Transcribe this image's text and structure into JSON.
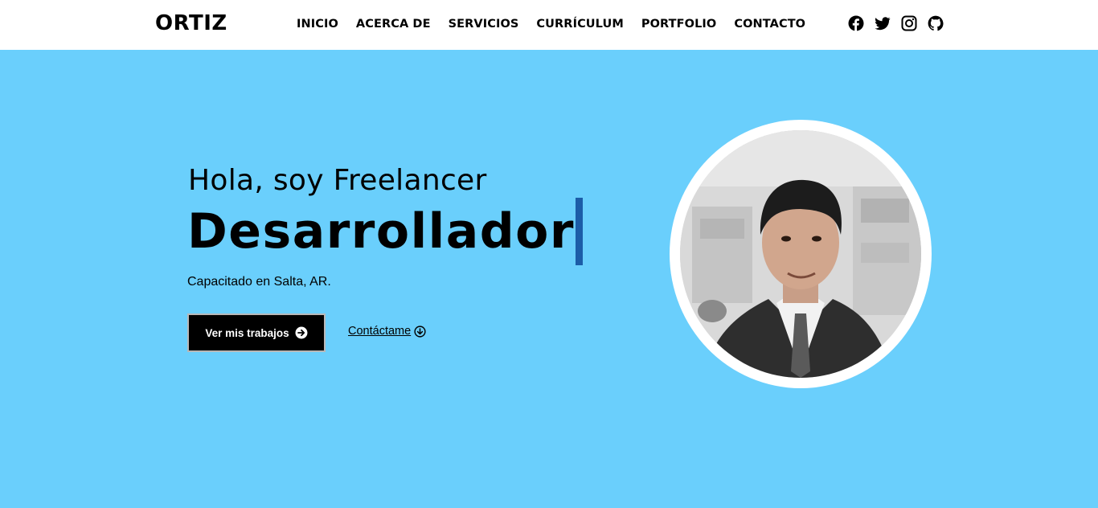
{
  "header": {
    "logo": "ORTIZ",
    "nav": [
      "INICIO",
      "ACERCA DE",
      "SERVICIOS",
      "CURRÍCULUM",
      "PORTFOLIO",
      "CONTACTO"
    ],
    "social_icons": [
      "facebook-icon",
      "twitter-icon",
      "instagram-icon",
      "github-icon"
    ]
  },
  "hero": {
    "intro": "Hola, soy Freelancer",
    "role": "Desarrollador",
    "subtitle": "Capacitado en Salta, AR.",
    "primary_button": "Ver mis trabajos",
    "secondary_link": "Contáctame"
  },
  "colors": {
    "background": "#6acffc",
    "cursor": "#1c5da8",
    "button_bg": "#000000"
  }
}
